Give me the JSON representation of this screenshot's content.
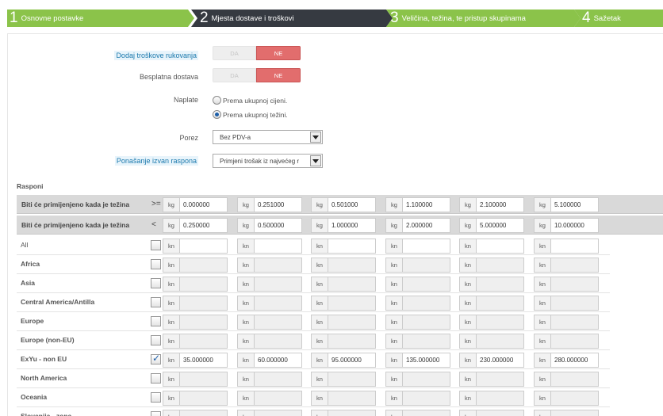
{
  "steps": [
    {
      "num": "1",
      "label": "Osnovne postavke"
    },
    {
      "num": "2",
      "label": "Mjesta dostave i troškovi"
    },
    {
      "num": "3",
      "label": "Veličina, težina, te pristup skupinama"
    },
    {
      "num": "4",
      "label": "Sažetak"
    }
  ],
  "form": {
    "handling_label": "Dodaj troškove rukovanja",
    "handling_off": "DA",
    "handling_on": "NE",
    "free_label": "Besplatna dostava",
    "free_off": "DA",
    "free_on": "NE",
    "billing_label": "Naplate",
    "billing_option_price": "Prema ukupnoj cijeni.",
    "billing_option_weight": "Prema ukupnoj težini.",
    "tax_label": "Porez",
    "tax_value": "Bez PDV-a",
    "range_behavior_label": "Ponašanje izvan raspona",
    "range_behavior_value": "Primjeni trošak iz najvećeg r"
  },
  "ranges": {
    "title": "Rasponi",
    "from_label": "Biti će primijenjeno kada je težina",
    "from_op": ">=",
    "to_label": "Biti će primijenjeno kada je težina",
    "to_op": "<",
    "weight_unit": "kg",
    "price_unit": "kn",
    "from_values": [
      "0.000000",
      "0.251000",
      "0.501000",
      "1.100000",
      "2.100000",
      "5.100000"
    ],
    "to_values": [
      "0.250000",
      "0.500000",
      "1.000000",
      "2.000000",
      "5.000000",
      "10.000000"
    ],
    "zones": [
      {
        "name": "All",
        "checked": false,
        "prices": [
          "",
          "",
          "",
          "",
          "",
          ""
        ]
      },
      {
        "name": "Africa",
        "checked": false,
        "prices": [
          "",
          "",
          "",
          "",
          "",
          ""
        ]
      },
      {
        "name": "Asia",
        "checked": false,
        "prices": [
          "",
          "",
          "",
          "",
          "",
          ""
        ]
      },
      {
        "name": "Central America/Antilla",
        "checked": false,
        "prices": [
          "",
          "",
          "",
          "",
          "",
          ""
        ]
      },
      {
        "name": "Europe",
        "checked": false,
        "prices": [
          "",
          "",
          "",
          "",
          "",
          ""
        ]
      },
      {
        "name": "Europe (non-EU)",
        "checked": false,
        "prices": [
          "",
          "",
          "",
          "",
          "",
          ""
        ]
      },
      {
        "name": "ExYu - non EU",
        "checked": true,
        "prices": [
          "35.000000",
          "60.000000",
          "95.000000",
          "135.000000",
          "230.000000",
          "280.000000"
        ]
      },
      {
        "name": "North America",
        "checked": false,
        "prices": [
          "",
          "",
          "",
          "",
          "",
          ""
        ]
      },
      {
        "name": "Oceania",
        "checked": false,
        "prices": [
          "",
          "",
          "",
          "",
          "",
          ""
        ]
      },
      {
        "name": "Slovenija - zona",
        "checked": false,
        "prices": [
          "",
          "",
          "",
          "",
          "",
          ""
        ]
      }
    ]
  },
  "colors": {
    "step_active": "#363a41",
    "step_inactive": "#8bc34a",
    "toggle_on": "#e26d6d",
    "help_text": "#1b79ad"
  }
}
